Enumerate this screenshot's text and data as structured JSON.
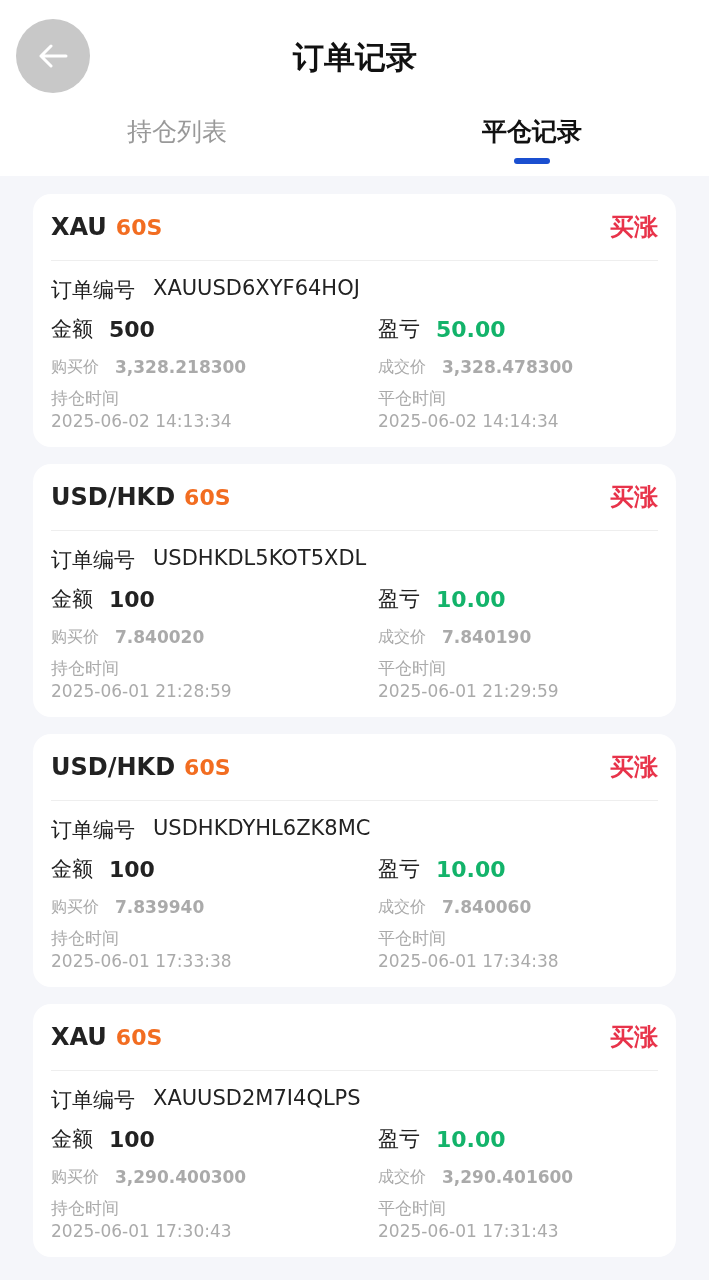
{
  "header": {
    "title": "订单记录"
  },
  "tabs": [
    {
      "label": "持仓列表",
      "selected": false
    },
    {
      "label": "平仓记录",
      "selected": true
    }
  ],
  "orders": [
    {
      "symbol": "XAU",
      "period": "60S",
      "direction": "买涨",
      "order_no_label": "订单编号",
      "order_no": "XAUUSD6XYF64HOJ",
      "amount_label": "金额",
      "amount": "500",
      "pnl_label": "盈亏",
      "pnl": "50.00",
      "buy_price_label": "购买价",
      "buy_price": "3,328.218300",
      "deal_price_label": "成交价",
      "deal_price": "3,328.478300",
      "open_time_label": "持仓时间",
      "open_time": "2025-06-02 14:13:34",
      "close_time_label": "平仓时间",
      "close_time": "2025-06-02 14:14:34"
    },
    {
      "symbol": "USD/HKD",
      "period": "60S",
      "direction": "买涨",
      "order_no_label": "订单编号",
      "order_no": "USDHKDL5KOT5XDL",
      "amount_label": "金额",
      "amount": "100",
      "pnl_label": "盈亏",
      "pnl": "10.00",
      "buy_price_label": "购买价",
      "buy_price": "7.840020",
      "deal_price_label": "成交价",
      "deal_price": "7.840190",
      "open_time_label": "持仓时间",
      "open_time": "2025-06-01 21:28:59",
      "close_time_label": "平仓时间",
      "close_time": "2025-06-01 21:29:59"
    },
    {
      "symbol": "USD/HKD",
      "period": "60S",
      "direction": "买涨",
      "order_no_label": "订单编号",
      "order_no": "USDHKDYHL6ZK8MC",
      "amount_label": "金额",
      "amount": "100",
      "pnl_label": "盈亏",
      "pnl": "10.00",
      "buy_price_label": "购买价",
      "buy_price": "7.839940",
      "deal_price_label": "成交价",
      "deal_price": "7.840060",
      "open_time_label": "持仓时间",
      "open_time": "2025-06-01 17:33:38",
      "close_time_label": "平仓时间",
      "close_time": "2025-06-01 17:34:38"
    },
    {
      "symbol": "XAU",
      "period": "60S",
      "direction": "买涨",
      "order_no_label": "订单编号",
      "order_no": "XAUUSD2M7I4QLPS",
      "amount_label": "金额",
      "amount": "100",
      "pnl_label": "盈亏",
      "pnl": "10.00",
      "buy_price_label": "购买价",
      "buy_price": "3,290.400300",
      "deal_price_label": "成交价",
      "deal_price": "3,290.401600",
      "open_time_label": "持仓时间",
      "open_time": "2025-06-01 17:30:43",
      "close_time_label": "平仓时间",
      "close_time": "2025-06-01 17:31:43"
    }
  ]
}
